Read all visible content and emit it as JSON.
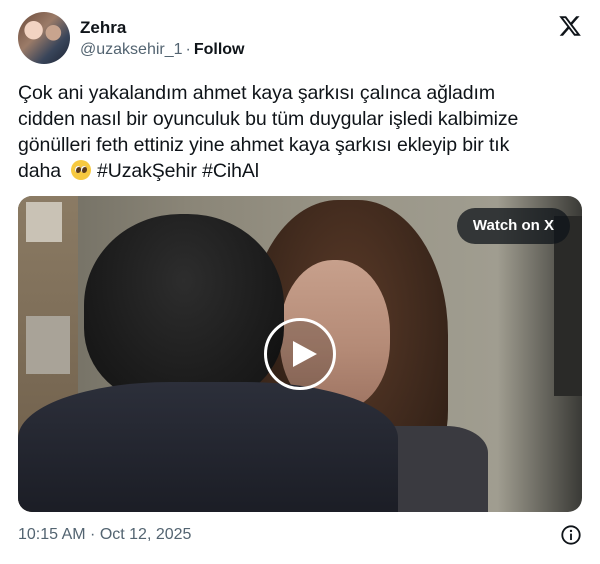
{
  "author": {
    "name": "Zehra",
    "handle": "@uzaksehir_1",
    "separator": "·",
    "follow_label": "Follow"
  },
  "tweet": {
    "lines": [
      "Çok ani yakalandım ahmet kaya şarkısı çalınca ağladım",
      "cidden nasıl bir oyunculuk bu tüm duygular işledi kalbimize",
      "gönülleri feth ettiniz yine ahmet kaya şarkısı ekleyip bir tık"
    ],
    "last_line_text": "daha",
    "emoji": "pleading-face",
    "hashtags": [
      "#UzakŞehir",
      "#CihAl"
    ]
  },
  "media": {
    "watch_label": "Watch on X",
    "play_icon": "play-icon"
  },
  "footer": {
    "timestamp": "10:15 AM · Oct 12, 2025",
    "info_icon": "info-icon"
  },
  "icons": {
    "brand": "x-logo-icon"
  }
}
